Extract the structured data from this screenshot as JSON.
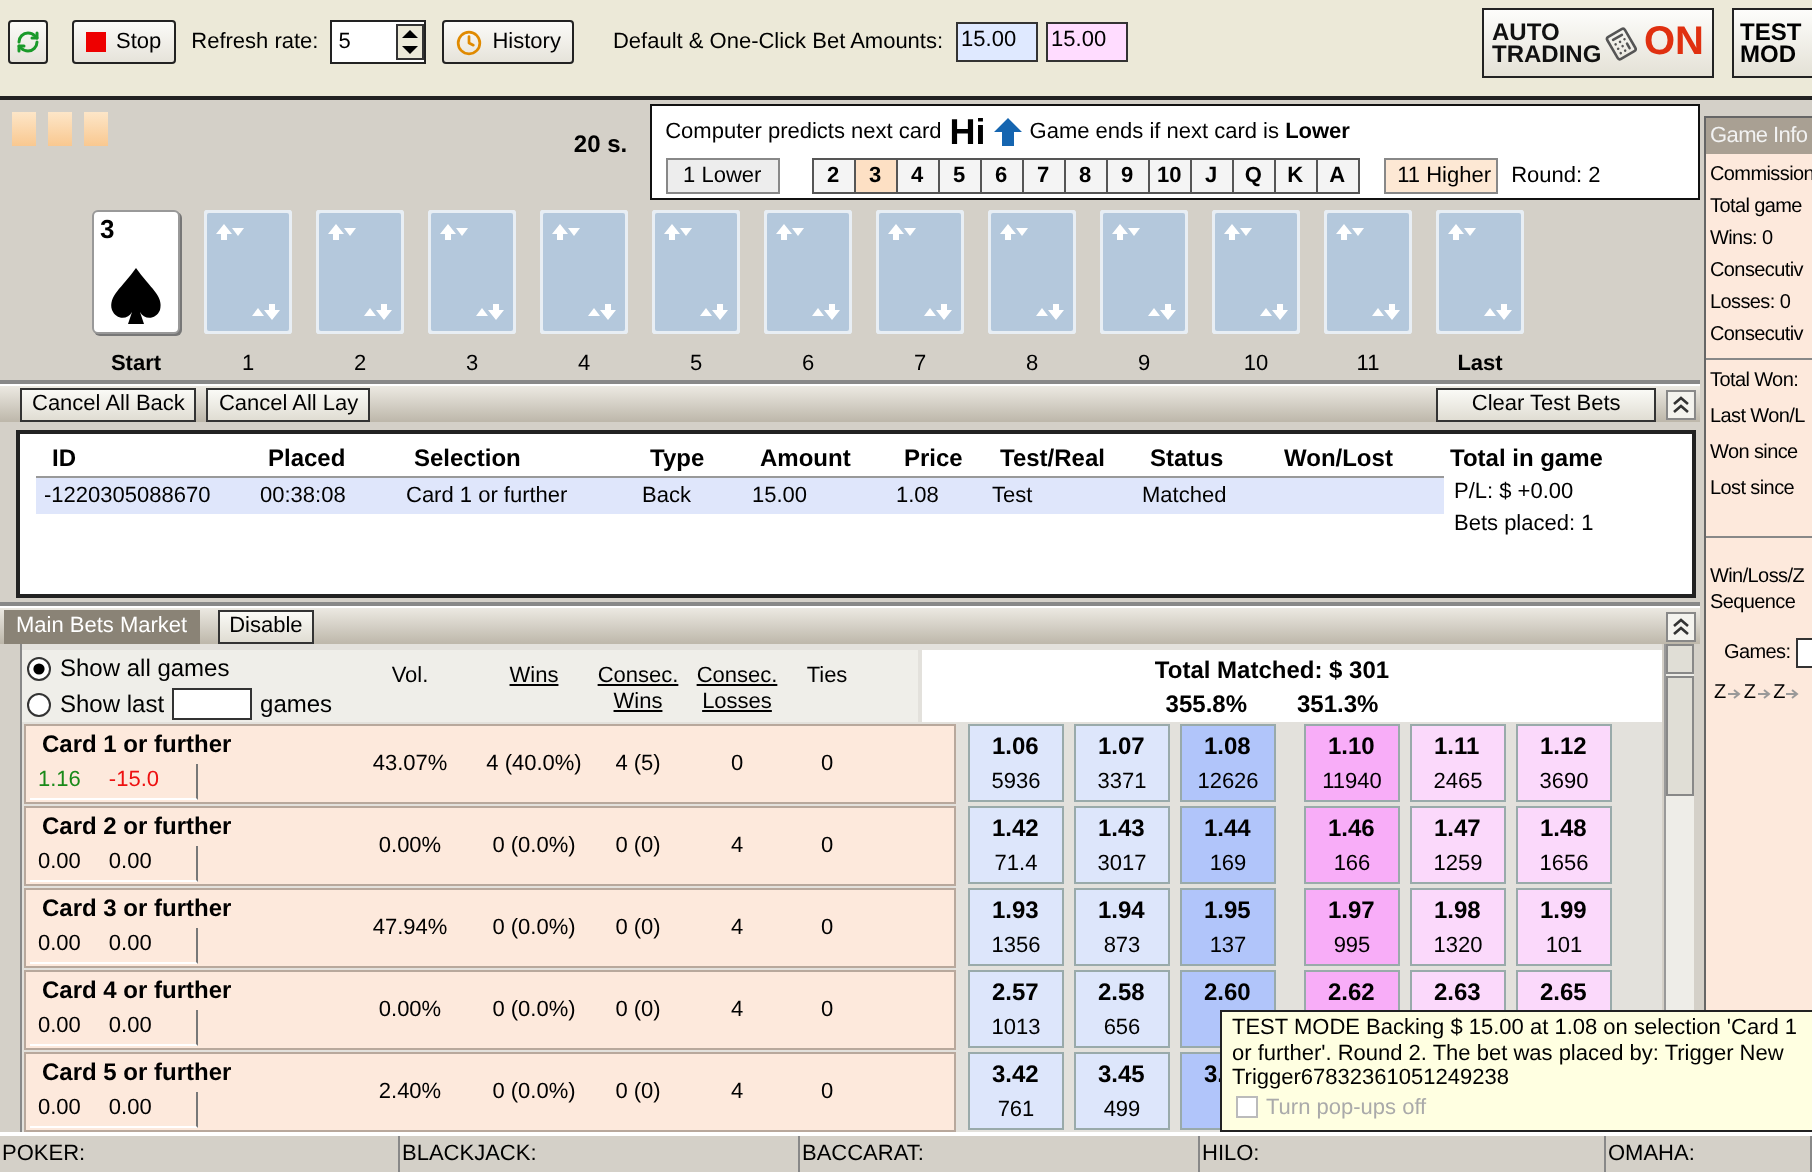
{
  "toolbar": {
    "stop_button": "Stop",
    "refresh_rate": {
      "label": "Refresh rate:",
      "value": "5"
    },
    "history_button": "History",
    "bet_amounts": {
      "label": "Default & One-Click Bet Amounts:",
      "default_amount": "15.00",
      "one_click_amount": "15.00"
    },
    "auto_trading": {
      "line1": "AUTO",
      "line2": "TRADING",
      "state": "ON"
    },
    "test_mode": {
      "line1": "TEST",
      "line2": "MOD"
    }
  },
  "game": {
    "timer": "20 s.",
    "prediction": {
      "label": "Computer predicts next card",
      "value": "Hi",
      "ends_text": "Game ends if next card is **Lower**"
    },
    "lower_button": {
      "label": "1 Lower",
      "highlighted": false
    },
    "ranks": [
      {
        "label": "2",
        "selected": false
      },
      {
        "label": "3",
        "selected": true
      },
      {
        "label": "4",
        "selected": false
      },
      {
        "label": "5",
        "selected": false
      },
      {
        "label": "6",
        "selected": false
      },
      {
        "label": "7",
        "selected": false
      },
      {
        "label": "8",
        "selected": false
      },
      {
        "label": "9",
        "selected": false
      },
      {
        "label": "10",
        "selected": false
      },
      {
        "label": "J",
        "selected": false
      },
      {
        "label": "Q",
        "selected": false
      },
      {
        "label": "K",
        "selected": false
      },
      {
        "label": "A",
        "selected": false
      }
    ],
    "higher_button": {
      "label": "11 Higher",
      "highlighted": true
    },
    "round": "Round: 2",
    "cards": [
      {
        "label": "Start",
        "face_up": true,
        "rank": "3",
        "kind": "spades"
      },
      {
        "label": "1",
        "face_up": false
      },
      {
        "label": "2",
        "face_up": false
      },
      {
        "label": "3",
        "face_up": false
      },
      {
        "label": "4",
        "face_up": false
      },
      {
        "label": "5",
        "face_up": false
      },
      {
        "label": "6",
        "face_up": false
      },
      {
        "label": "7",
        "face_up": false
      },
      {
        "label": "8",
        "face_up": false
      },
      {
        "label": "9",
        "face_up": false
      },
      {
        "label": "10",
        "face_up": false
      },
      {
        "label": "11",
        "face_up": false
      },
      {
        "label": "Last",
        "face_up": false
      }
    ]
  },
  "bets": {
    "buttons": [
      "Cancel All Back",
      "Cancel All Lay"
    ],
    "clear_button": "Clear Test Bets",
    "columns": [
      "ID",
      "Placed",
      "Selection",
      "Type",
      "Amount",
      "Price",
      "Test/Real",
      "Status",
      "Won/Lost"
    ],
    "rows": [
      {
        "selected": true,
        "cells": [
          "-1220305088670",
          "00:38:08",
          "Card 1 or further",
          "Back",
          "15.00",
          "1.08",
          "Test",
          "Matched"
        ]
      }
    ],
    "total": {
      "title": "Total in game",
      "pl": "P/L: $ +0.00",
      "placed": "Bets placed: 1"
    }
  },
  "market": {
    "title": "Main Bets Market",
    "disable_button": "Disable",
    "filters": [
      {
        "label": "Show all games",
        "selected": true
      },
      {
        "label": "Show last",
        "selected": false,
        "suffix": "games"
      }
    ],
    "columns": [
      {
        "label": "Vol.",
        "underlined": false
      },
      {
        "label": "Wins",
        "underlined": true
      },
      {
        "label": "Consec. Wins",
        "underlined": true
      },
      {
        "label": "Consec. Losses",
        "underlined": true
      },
      {
        "label": "Ties",
        "underlined": false
      }
    ],
    "total_matched": "Total Matched: $ 301",
    "back_percent": "355.8%",
    "lay_percent": "351.3%",
    "rows": [
      {
        "name": "Card 1 or further",
        "pl_active": true,
        "back_pl": "1.16",
        "lay_pl": "-15.0",
        "vol": "43.07%",
        "wins": "4 (40.0%)",
        "consec_wins": "4 (5)",
        "consec_losses": "0",
        "ties": "0",
        "back": [
          {
            "price": "1.06",
            "size": "5936",
            "best": false
          },
          {
            "price": "1.07",
            "size": "3371",
            "best": false
          },
          {
            "price": "1.08",
            "size": "12626",
            "best": true
          }
        ],
        "lay": [
          {
            "price": "1.10",
            "size": "11940",
            "best": true
          },
          {
            "price": "1.11",
            "size": "2465",
            "best": false
          },
          {
            "price": "1.12",
            "size": "3690",
            "best": false
          }
        ]
      },
      {
        "name": "Card 2 or further",
        "pl_active": false,
        "back_pl": "0.00",
        "lay_pl": "0.00",
        "vol": "0.00%",
        "wins": "0 (0.0%)",
        "consec_wins": "0 (0)",
        "consec_losses": "4",
        "ties": "0",
        "back": [
          {
            "price": "1.42",
            "size": "71.4",
            "best": false
          },
          {
            "price": "1.43",
            "size": "3017",
            "best": false
          },
          {
            "price": "1.44",
            "size": "169",
            "best": true
          }
        ],
        "lay": [
          {
            "price": "1.46",
            "size": "166",
            "best": true
          },
          {
            "price": "1.47",
            "size": "1259",
            "best": false
          },
          {
            "price": "1.48",
            "size": "1656",
            "best": false
          }
        ]
      },
      {
        "name": "Card 3 or further",
        "pl_active": false,
        "back_pl": "0.00",
        "lay_pl": "0.00",
        "vol": "47.94%",
        "wins": "0 (0.0%)",
        "consec_wins": "0 (0)",
        "consec_losses": "4",
        "ties": "0",
        "back": [
          {
            "price": "1.93",
            "size": "1356",
            "best": false
          },
          {
            "price": "1.94",
            "size": "873",
            "best": false
          },
          {
            "price": "1.95",
            "size": "137",
            "best": true
          }
        ],
        "lay": [
          {
            "price": "1.97",
            "size": "995",
            "best": true
          },
          {
            "price": "1.98",
            "size": "1320",
            "best": false
          },
          {
            "price": "1.99",
            "size": "101",
            "best": false
          }
        ]
      },
      {
        "name": "Card 4 or further",
        "pl_active": false,
        "back_pl": "0.00",
        "lay_pl": "0.00",
        "vol": "0.00%",
        "wins": "0 (0.0%)",
        "consec_wins": "0 (0)",
        "consec_losses": "4",
        "ties": "0",
        "back": [
          {
            "price": "2.57",
            "size": "1013",
            "best": false
          },
          {
            "price": "2.58",
            "size": "656",
            "best": false
          },
          {
            "price": "2.60",
            "best": true
          }
        ],
        "lay": [
          {
            "price": "2.62",
            "best": true
          },
          {
            "price": "2.63",
            "best": false
          },
          {
            "price": "2.65",
            "best": false
          }
        ]
      },
      {
        "name": "Card 5 or further",
        "pl_active": false,
        "back_pl": "0.00",
        "lay_pl": "0.00",
        "vol": "2.40%",
        "wins": "0 (0.0%)",
        "consec_wins": "0 (0)",
        "consec_losses": "4",
        "ties": "0",
        "back": [
          {
            "price": "3.42",
            "size": "761",
            "best": false
          },
          {
            "price": "3.45",
            "size": "499",
            "best": false
          },
          {
            "price": "3.",
            "best": true
          }
        ]
      }
    ]
  },
  "game_info": {
    "title": "Game Info",
    "stats": [
      "Commission",
      "Total game",
      "Wins: 0",
      "Consecutiv",
      "Losses: 0",
      "Consecutiv"
    ],
    "totals": [
      "Total Won:",
      "Last Won/L",
      "Won since",
      "Lost since"
    ],
    "sequence_label": "Win/Loss/Z",
    "sequence_label_2": "Sequence",
    "games_label": "Games:",
    "sequence": [
      "Z",
      "Z",
      "Z"
    ]
  },
  "tooltip": {
    "text": "TEST MODE Backing $ 15.00 at 1.08 on selection 'Card 1 or further'. Round 2. The bet was placed by: Trigger New Trigger67832361051249238",
    "checkbox": {
      "label": "Turn pop-ups off",
      "checked": false,
      "disabled": true
    }
  },
  "status_bar": [
    "POKER:",
    "BLACKJACK:",
    "BACCARAT:",
    "HILO:",
    "OMAHA:"
  ]
}
